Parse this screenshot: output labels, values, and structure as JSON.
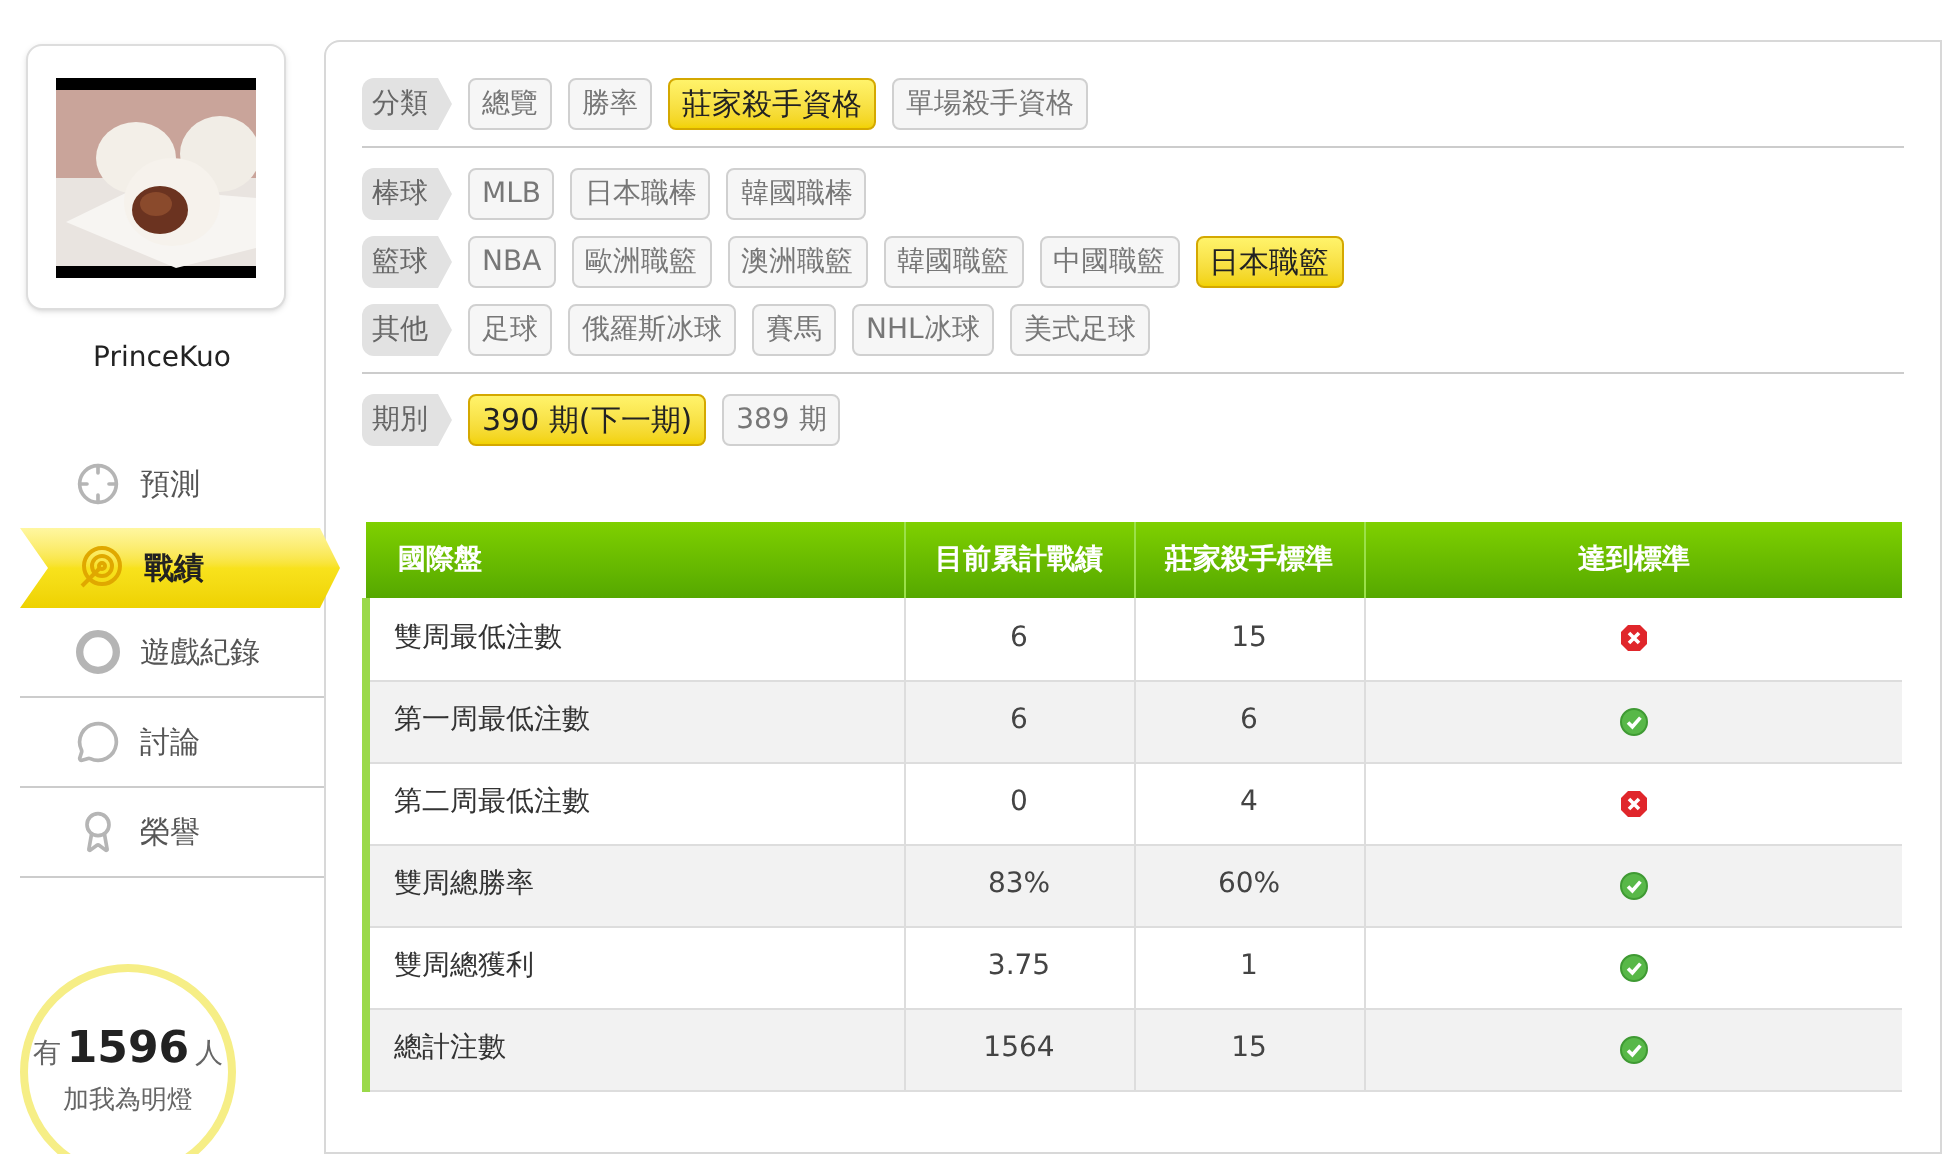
{
  "user": {
    "name": "PrinceKuo"
  },
  "nav": [
    {
      "label": "預測",
      "kind": "crosshair",
      "selected": false
    },
    {
      "label": "戰績",
      "kind": "target",
      "selected": true
    },
    {
      "label": "遊戲紀錄",
      "kind": "ring",
      "selected": false
    },
    {
      "label": "討論",
      "kind": "discuss",
      "selected": false
    },
    {
      "label": "榮譽",
      "kind": "medal",
      "selected": false
    }
  ],
  "fans": {
    "prefix": "有",
    "count": "1596",
    "suffix": "人",
    "caption": "加我為明燈"
  },
  "filters": [
    {
      "rows": [
        {
          "label": "分類",
          "options": [
            {
              "label": "總覽",
              "selected": false
            },
            {
              "label": "勝率",
              "selected": false
            },
            {
              "label": "莊家殺手資格",
              "selected": true
            },
            {
              "label": "單場殺手資格",
              "selected": false
            }
          ]
        }
      ]
    },
    {
      "rows": [
        {
          "label": "棒球",
          "options": [
            {
              "label": "MLB",
              "selected": false
            },
            {
              "label": "日本職棒",
              "selected": false
            },
            {
              "label": "韓國職棒",
              "selected": false
            }
          ]
        },
        {
          "label": "籃球",
          "options": [
            {
              "label": "NBA",
              "selected": false
            },
            {
              "label": "歐洲職籃",
              "selected": false
            },
            {
              "label": "澳洲職籃",
              "selected": false
            },
            {
              "label": "韓國職籃",
              "selected": false
            },
            {
              "label": "中國職籃",
              "selected": false
            },
            {
              "label": "日本職籃",
              "selected": true
            }
          ]
        },
        {
          "label": "其他",
          "options": [
            {
              "label": "足球",
              "selected": false
            },
            {
              "label": "俄羅斯冰球",
              "selected": false
            },
            {
              "label": "賽馬",
              "selected": false
            },
            {
              "label": "NHL冰球",
              "selected": false
            },
            {
              "label": "美式足球",
              "selected": false
            }
          ]
        }
      ]
    },
    {
      "rows": [
        {
          "label": "期別",
          "options": [
            {
              "label": "390 期(下一期)",
              "selected": true
            },
            {
              "label": "389 期",
              "selected": false
            }
          ]
        }
      ]
    }
  ],
  "table": {
    "columns": [
      "國際盤",
      "目前累計戰績",
      "莊家殺手標準",
      "達到標準"
    ],
    "rows": [
      {
        "cells": [
          "雙周最低注數",
          "6",
          "15"
        ],
        "met": false
      },
      {
        "cells": [
          "第一周最低注數",
          "6",
          "6"
        ],
        "met": true
      },
      {
        "cells": [
          "第二周最低注數",
          "0",
          "4"
        ],
        "met": false
      },
      {
        "cells": [
          "雙周總勝率",
          "83%",
          "60%"
        ],
        "met": true
      },
      {
        "cells": [
          "雙周總獲利",
          "3.75",
          "1"
        ],
        "met": true
      },
      {
        "cells": [
          "總計注數",
          "1564",
          "15"
        ],
        "met": true
      }
    ]
  }
}
